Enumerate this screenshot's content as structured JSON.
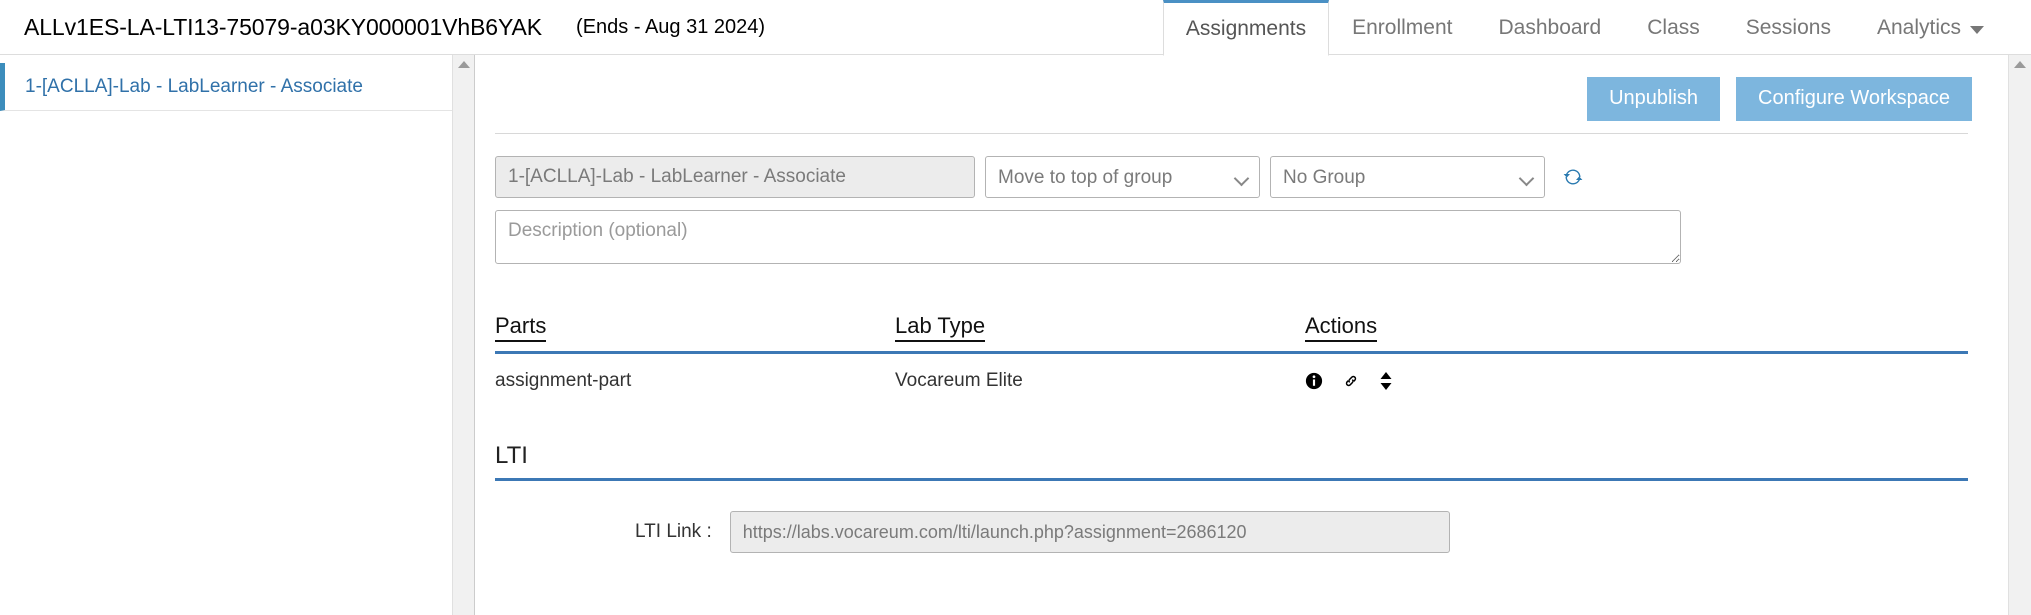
{
  "header": {
    "course_code": "ALLv1ES-LA-LTI13-75079-a03KY000001VhB6YAK",
    "course_ends": "(Ends - Aug 31 2024)",
    "tabs": [
      {
        "label": "Assignments",
        "active": true
      },
      {
        "label": "Enrollment",
        "active": false
      },
      {
        "label": "Dashboard",
        "active": false
      },
      {
        "label": "Class",
        "active": false
      },
      {
        "label": "Sessions",
        "active": false
      },
      {
        "label": "Analytics",
        "active": false,
        "has_caret": true
      }
    ]
  },
  "sidebar": {
    "items": [
      {
        "label": "1-[ACLLA]-Lab - LabLearner - Associate",
        "selected": true
      }
    ]
  },
  "toolbar": {
    "unpublish_label": "Unpublish",
    "configure_workspace_label": "Configure Workspace"
  },
  "form": {
    "assignment_title_value": "1-[ACLLA]-Lab - LabLearner - Associate",
    "move_select_value": "Move to top of group",
    "group_select_value": "No Group",
    "refresh_icon": "refresh-icon",
    "description_placeholder": "Description (optional)",
    "description_value": ""
  },
  "parts_table": {
    "columns": [
      "Parts",
      "Lab Type",
      "Actions"
    ],
    "rows": [
      {
        "part": "assignment-part",
        "lab_type": "Vocareum Elite",
        "actions": [
          "info-icon",
          "link-icon",
          "sort-updown-icon"
        ]
      }
    ]
  },
  "lti": {
    "section_title": "LTI",
    "link_label": "LTI Link :",
    "link_value": "https://labs.vocareum.com/lti/launch.php?assignment=2686120"
  },
  "colors": {
    "accent_blue": "#3c78b5",
    "button_blue": "#7db6de",
    "tab_active_top": "#4a90c4",
    "sidebar_accent": "#3c8dbc",
    "link_text": "#3071a9"
  }
}
